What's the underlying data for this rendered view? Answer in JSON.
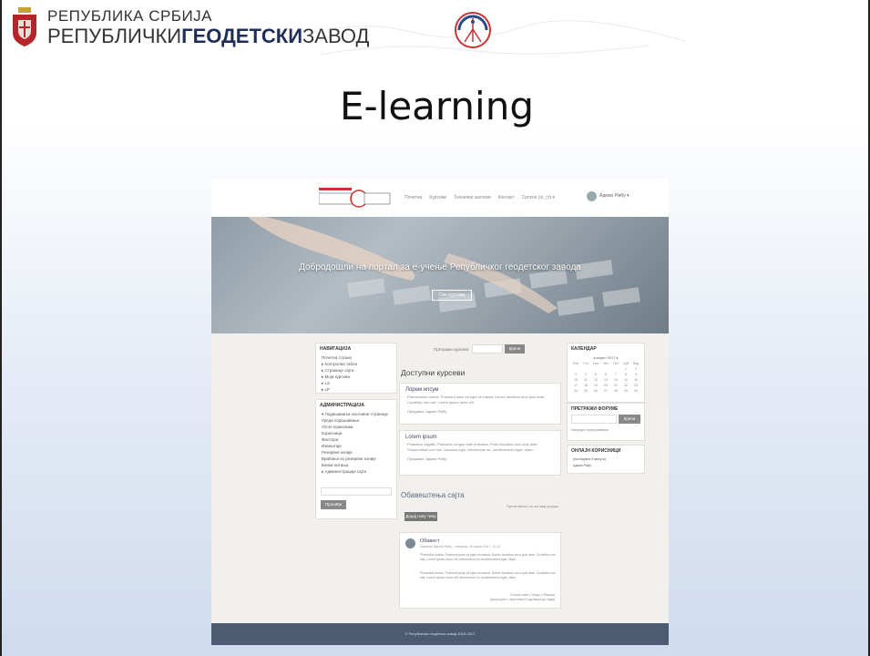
{
  "header": {
    "org_line1": "РЕПУБЛИКА СРБИЈА",
    "org_line2_a": "РЕПУБЛИЧКИ",
    "org_line2_b": "ГЕОДЕТСКИ",
    "org_line2_c": "ЗАВОД",
    "coat_icon": "serbian-coat-of-arms-icon",
    "logo_icon": "rgz-logo-icon"
  },
  "slide_title": "E-learning",
  "portal": {
    "nav_links": [
      "Почетна",
      "Курсеви",
      "Технички захтеви",
      "Контакт",
      "Српски (sr_cr) ▾"
    ],
    "user": "Админ Рмбу ▾",
    "hero_text": "Добродошли на портал за е-учење Републичког геодетског завода",
    "hero_button": "Сви курсеви",
    "nav_block": {
      "title": "НАВИГАЦИЈА",
      "items": [
        "Почетна страна",
        "▸ Контролна табла",
        "▸ Странице сајта",
        "▸ Моји курсеви",
        "   ▸ LS",
        "   ▸ LP"
      ]
    },
    "admin_block": {
      "title": "АДМИНИСТРАЦИЈА",
      "items": [
        "▾ Подешавања насловне странице",
        "   Уреди подешавања",
        "   Улоге корисника",
        "   Корисници",
        "   Филтери",
        "   Извештаји",
        "   Резервне копије",
        "   Враћање из резервне копије",
        "   Банка питања",
        "▸ Администрација сајта"
      ],
      "button": "Пронађи"
    },
    "search_label": "Претражи курсеве:",
    "search_button": "Крени",
    "courses_heading": "Доступни курсеви",
    "courses": [
      {
        "title": "Лорем ипсум",
        "desc": "Praesentium metus. Praesent justo ad eget ut massa. Donec faucibus arcu quis ante. Curabitur non nisl. Lorem ipsum dolor elit.",
        "teacher": "Предавач: Админ Рмбу"
      },
      {
        "title": "Lorem ipsum",
        "desc": "Phasellus sagittis. Praesent congue erat at massa. Proin faucibus arcu quis ante. Suspendisse non nisl. Vivamus eget, elementum ac, condimentum eget, diam.",
        "teacher": "Предавач: Админ Рмбу"
      }
    ],
    "news_heading": "Обавештења сајта",
    "news_sub": "Претплатите се на овај форум",
    "news_button": "Додај нову тему",
    "post": {
      "title": "Обавест",
      "meta": "Написао Админ Рмбу - четвртак, 20 април 2017, 10:10",
      "p1": "Phasellus metus. Praesent justo at eget ut massa. Donec faucibus arcu quis ante. Curabitur non nisl. Lorem ipsum dolor elit, elementum eu condimentum eget, diam.",
      "p2": "Phasellus metus. Praesent justo at eget ut massa. Donec faucibus arcu quis ante. Curabitur non nisl. Lorem ipsum dolor elit, elementum eu condimentum eget, diam.",
      "f1": "Стални линк | Уреди | Обриши",
      "f2": "Дискутујте о овој теми (0 одговора до сада)"
    },
    "calendar": {
      "title": "КАЛЕНДАР",
      "month": "◂   април 2017   ▸",
      "days": [
        "Пон",
        "Уто",
        "Сре",
        "Чет",
        "Пет",
        "Суб",
        "Нед"
      ],
      "weeks": [
        [
          "",
          "",
          "",
          "",
          "",
          "1",
          "2"
        ],
        [
          "3",
          "4",
          "5",
          "6",
          "7",
          "8",
          "9"
        ],
        [
          "10",
          "11",
          "12",
          "13",
          "14",
          "15",
          "16"
        ],
        [
          "17",
          "18",
          "19",
          "20",
          "21",
          "22",
          "23"
        ],
        [
          "24",
          "25",
          "26",
          "27",
          "28",
          "29",
          "30"
        ]
      ]
    },
    "forum": {
      "title": "ПРЕТРАЖИ ФОРУМЕ",
      "button": "Крени",
      "advanced": "Напредно претраживање"
    },
    "recent": {
      "title": "ОНЛАЈН КОРИСНИЦИ",
      "line1": "(последњих 5 минута)",
      "line2": "Админ Рмбу"
    },
    "footer": "© Републички геодетски завод 2016-2017"
  }
}
